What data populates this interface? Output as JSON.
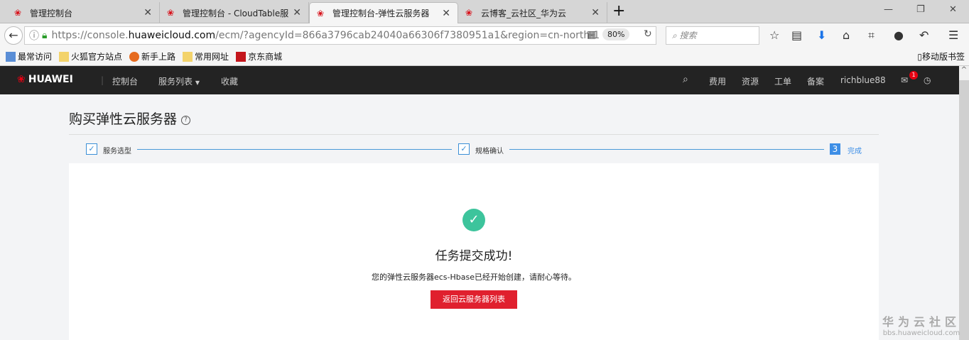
{
  "browser": {
    "tabs": [
      {
        "title": "管理控制台"
      },
      {
        "title": "管理控制台 - CloudTable服"
      },
      {
        "title": "管理控制台-弹性云服务器",
        "active": true
      },
      {
        "title": "云博客_云社区_华为云"
      }
    ],
    "url_prefix": "https://console.",
    "url_domain": "huaweicloud.com",
    "url_rest": "/ecm/?agencyId=866a3796cab24040a66306f7380951a1&region=cn-north-1",
    "zoom": "80%",
    "search_placeholder": "搜索",
    "bookmarks": [
      "最常访问",
      "火狐官方站点",
      "新手上路",
      "常用网址",
      "京东商城"
    ],
    "mobile_bookmarks": "移动版书签"
  },
  "header": {
    "brand": "HUAWEI",
    "nav": [
      "控制台",
      "服务列表",
      "收藏"
    ],
    "right": [
      "费用",
      "资源",
      "工单",
      "备案"
    ],
    "user": "richblue88",
    "message_count": "1"
  },
  "page": {
    "title": "购买弹性云服务器",
    "steps": [
      {
        "label": "服务选型",
        "status": "done"
      },
      {
        "label": "规格确认",
        "status": "done"
      },
      {
        "number": "3",
        "label": "完成",
        "status": "current"
      }
    ],
    "success_title": "任务提交成功!",
    "success_message": "您的弹性云服务器ecs-Hbase已经开始创建，请耐心等待。",
    "back_button": "返回云服务器列表"
  },
  "watermark": {
    "title": "华为云社区",
    "url": "bbs.huaweicloud.com"
  },
  "colors": {
    "accent": "#3b8fd6",
    "success": "#3dc49c",
    "primary_button": "#e0202e",
    "header": "#232323"
  }
}
